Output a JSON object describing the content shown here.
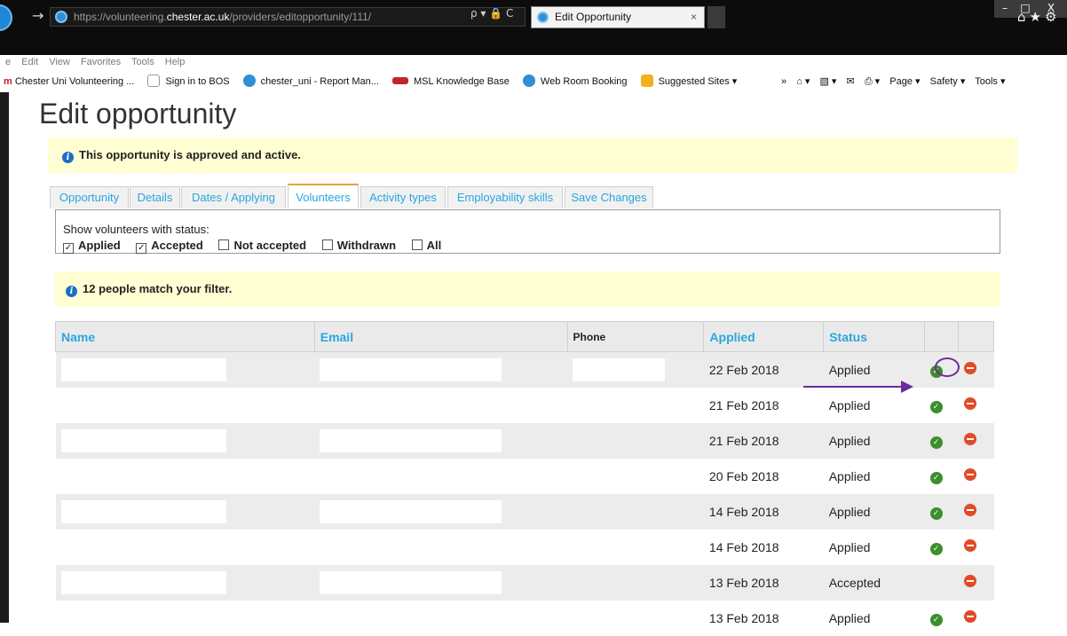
{
  "browser": {
    "address_prefix": "https://volunteering.",
    "address_host": "chester.ac.uk",
    "address_path": "/providers/editopportunity/111/",
    "address_controls": "ρ ▾ 🔒 C",
    "tab_title": "Edit Opportunity",
    "tab_close": "×",
    "window_min": "–",
    "window_max": "□",
    "window_close": "X",
    "right_icons": "⌂★⚙"
  },
  "menu": [
    "e",
    "Edit",
    "View",
    "Favorites",
    "Tools",
    "Help"
  ],
  "favorites": [
    {
      "label": "Chester Uni Volunteering ...",
      "icon": "m"
    },
    {
      "label": "Sign in to BOS",
      "icon": "bos"
    },
    {
      "label": "chester_uni - Report Man...",
      "icon": "ie"
    },
    {
      "label": "MSL Knowledge Base",
      "icon": "msl"
    },
    {
      "label": "Web Room Booking",
      "icon": "ie"
    },
    {
      "label": "Suggested Sites ▾",
      "icon": "bing"
    }
  ],
  "favorites_right": [
    "»",
    "⌂ ▾",
    "▧ ▾",
    "✉",
    "⎙ ▾",
    "Page ▾",
    "Safety ▾",
    "Tools ▾"
  ],
  "page": {
    "title": "Edit opportunity",
    "status_notice": "This opportunity is approved and active.",
    "tabs": [
      "Opportunity",
      "Details",
      "Dates / Applying",
      "Volunteers",
      "Activity types",
      "Employability skills",
      "Save Changes"
    ],
    "active_tab": "Volunteers",
    "filter_label": "Show volunteers with status:",
    "filters": [
      {
        "label": "Applied",
        "checked": true
      },
      {
        "label": "Accepted",
        "checked": true
      },
      {
        "label": "Not accepted",
        "checked": false
      },
      {
        "label": "Withdrawn",
        "checked": false
      },
      {
        "label": "All",
        "checked": false
      }
    ],
    "match_notice": "12 people match your filter."
  },
  "table": {
    "headers": {
      "name": "Name",
      "email": "Email",
      "phone": "Phone",
      "applied": "Applied",
      "status": "Status"
    },
    "rows": [
      {
        "applied": "22 Feb 2018",
        "status": "Applied",
        "accept": true,
        "reject": true
      },
      {
        "applied": "21 Feb 2018",
        "status": "Applied",
        "accept": true,
        "reject": true
      },
      {
        "applied": "21 Feb 2018",
        "status": "Applied",
        "accept": true,
        "reject": true
      },
      {
        "applied": "20 Feb 2018",
        "status": "Applied",
        "accept": true,
        "reject": true
      },
      {
        "applied": "14 Feb 2018",
        "status": "Applied",
        "accept": true,
        "reject": true
      },
      {
        "applied": "14 Feb 2018",
        "status": "Applied",
        "accept": true,
        "reject": true
      },
      {
        "applied": "13 Feb 2018",
        "status": "Accepted",
        "accept": false,
        "reject": true
      },
      {
        "applied": "13 Feb 2018",
        "status": "Applied",
        "accept": true,
        "reject": true
      }
    ]
  },
  "colors": {
    "accent": "#29a6e0",
    "notice_bg": "#ffffd3",
    "annotation": "#6a2a9c",
    "accept": "#3d8e2e",
    "reject": "#e24a25"
  }
}
